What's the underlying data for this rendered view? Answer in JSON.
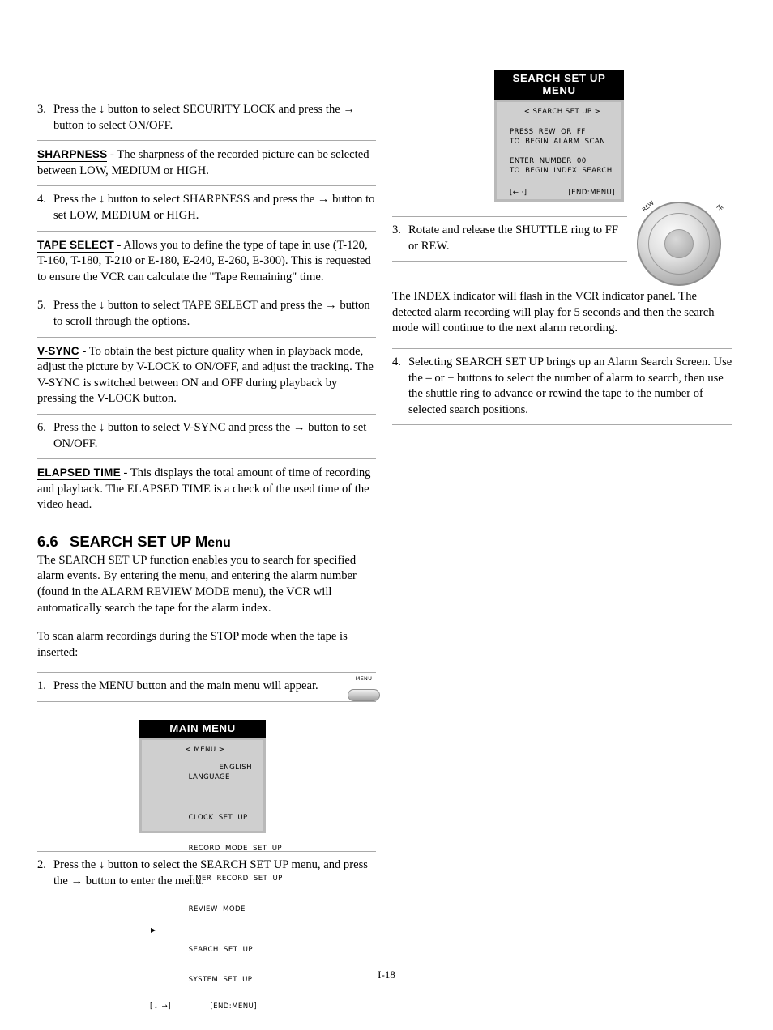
{
  "page": {
    "footer": "I-18"
  },
  "left_column": {
    "items": [
      {
        "type": "numbered",
        "num": "3.",
        "text": "Press the ↓ button to select SECURITY LOCK and press the → button to select ON/OFF."
      },
      {
        "type": "term",
        "term": "SHARPNESS",
        "text": " - The sharpness of the recorded picture can be selected between LOW, MEDIUM or HIGH."
      },
      {
        "type": "numbered",
        "num": "4.",
        "text": "Press the ↓ button to select SHARPNESS and press the → button  to set LOW, MEDIUM or HIGH."
      },
      {
        "type": "term",
        "term": "TAPE SELECT",
        "text": " - Allows you to define the type of tape in use (T-120, T-160, T-180, T-210 or E-180, E-240, E-260, E-300). This is requested to ensure the VCR can calculate the \"Tape Remaining\" time."
      },
      {
        "type": "numbered",
        "num": "5.",
        "text": "Press the ↓ button to select TAPE SELECT and press the → button to scroll through the options."
      },
      {
        "type": "term",
        "term": "V-SYNC",
        "text": " - To obtain the best picture quality when in playback mode, adjust the picture by V-LOCK to ON/OFF, and adjust the tracking.  The V-SYNC is switched between ON and OFF during playback by pressing the V-LOCK button."
      },
      {
        "type": "numbered",
        "num": "6.",
        "text": "Press the ↓ button to select V-SYNC and press the → button to set ON/OFF."
      },
      {
        "type": "term",
        "term": "ELAPSED TIME",
        "text": " - This displays the total amount of time of recording and playback. The ELAPSED TIME is a check of the used time of the video head."
      }
    ],
    "section": {
      "number": "6.6",
      "title_bold": "SEARCH SET UP M",
      "title_rest": "enu",
      "paragraph1": "The SEARCH SET UP function enables you to search for specified alarm events.  By entering the menu, and entering the alarm number (found in the ALARM REVIEW MODE menu), the VCR will automatically search the tape for the alarm index.",
      "paragraph2": "To scan alarm recordings during the STOP mode when the tape is inserted:"
    },
    "step1": {
      "num": "1.",
      "text": "Press the MENU button and the main menu will appear.",
      "button_caption": "MENU"
    },
    "step2": {
      "num": "2.",
      "text": "Press the ↓ button to select the SEARCH SET UP menu, and press the → button to enter the menu."
    },
    "main_menu": {
      "title": "MAIN MENU",
      "header": "< MENU >",
      "rows": [
        {
          "label": "LANGUAGE",
          "value": "ENGLISH",
          "selected": false
        },
        {
          "label": "CLOCK  SET  UP",
          "value": "",
          "selected": false
        },
        {
          "label": "RECORD  MODE  SET  UP",
          "value": "",
          "selected": false
        },
        {
          "label": "TIMER  RECORD  SET  UP",
          "value": "",
          "selected": false
        },
        {
          "label": "REVIEW  MODE",
          "value": "",
          "selected": false
        },
        {
          "label": "SEARCH  SET  UP",
          "value": "",
          "selected": true
        },
        {
          "label": "SYSTEM  SET  UP",
          "value": "",
          "selected": false
        }
      ],
      "foot_left": "[↓    →]",
      "foot_right": "[END:MENU]"
    }
  },
  "right_column": {
    "search_menu": {
      "title": "SEARCH SET UP MENU",
      "header": "< SEARCH SET UP >",
      "line1": "PRESS  REW  OR  FF",
      "line2": "TO  BEGIN  ALARM  SCAN",
      "line3": "ENTER  NUMBER  00",
      "line4": "TO  BEGIN  INDEX  SEARCH",
      "foot_left": "[←      ·]",
      "foot_right": "[END:MENU]"
    },
    "step3": {
      "num": "3.",
      "text": "Rotate and release the SHUTTLE ring to FF or REW."
    },
    "shuttle": {
      "label_rew": "REW",
      "label_ff": "FF"
    },
    "paragraph": "The INDEX indicator will flash in the VCR indicator panel. The detected alarm recording will play for 5 seconds and then the search mode will continue to the next alarm recording.",
    "step4": {
      "num": "4.",
      "text": "Selecting SEARCH SET UP brings up an Alarm Search Screen. Use the – or + buttons to select the number of alarm to search, then use the shuttle ring to advance or rewind the tape to the number of selected search positions."
    }
  }
}
